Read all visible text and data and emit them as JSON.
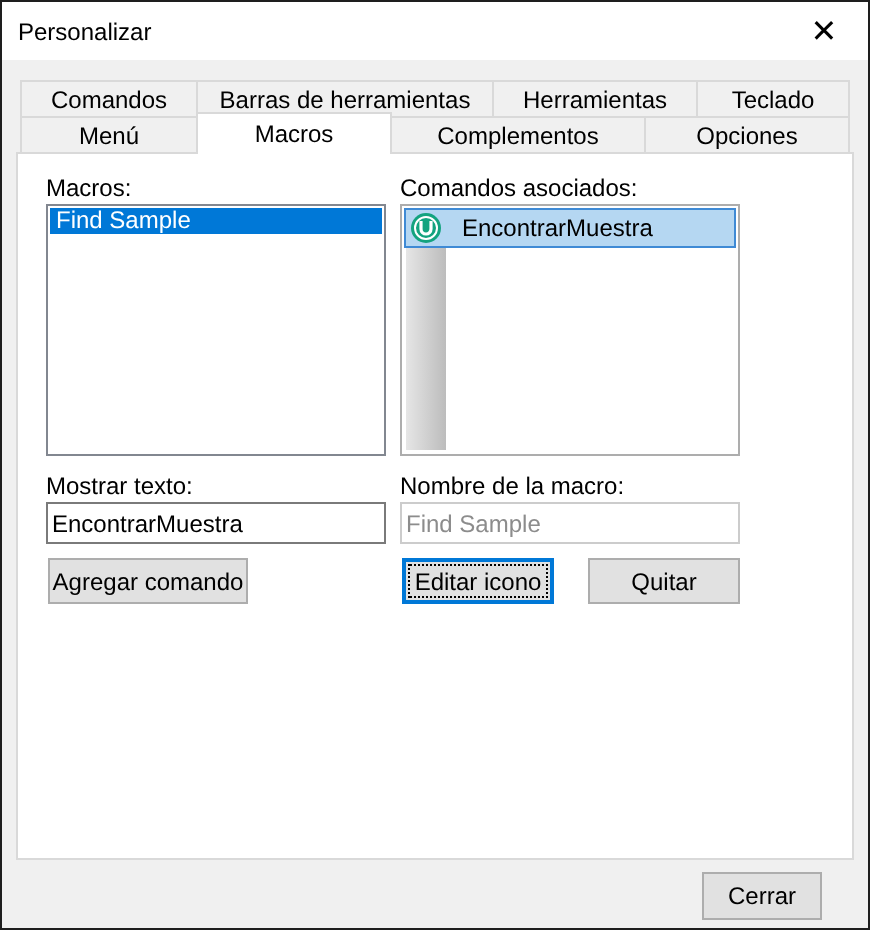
{
  "window": {
    "title": "Personalizar",
    "close": "✕"
  },
  "tab_rows": [
    [
      {
        "label": "Comandos",
        "selected": false
      },
      {
        "label": "Barras de herramientas",
        "selected": false
      },
      {
        "label": "Herramientas",
        "selected": false
      },
      {
        "label": "Teclado",
        "selected": false
      }
    ],
    [
      {
        "label": "Menú",
        "selected": false
      },
      {
        "label": "Macros",
        "selected": true
      },
      {
        "label": "Complementos",
        "selected": false
      },
      {
        "label": "Opciones",
        "selected": false
      }
    ]
  ],
  "macros": {
    "label": "Macros:",
    "items": [
      {
        "text": "Find Sample",
        "selected": true
      }
    ]
  },
  "commands": {
    "label": "Comandos asociados:",
    "items": [
      {
        "text": "EncontrarMuestra",
        "selected": true
      }
    ]
  },
  "display_text": {
    "label": "Mostrar texto:",
    "value": "EncontrarMuestra"
  },
  "macro_name": {
    "label": "Nombre de la macro:",
    "value": "Find Sample",
    "disabled": true
  },
  "buttons": [
    {
      "label": "Agregar comando",
      "focused": false
    },
    {
      "label": "Editar icono",
      "focused": true
    },
    {
      "label": "Quitar",
      "focused": false
    }
  ],
  "footer_buttons": [
    {
      "label": "Cerrar",
      "focused": false
    }
  ]
}
